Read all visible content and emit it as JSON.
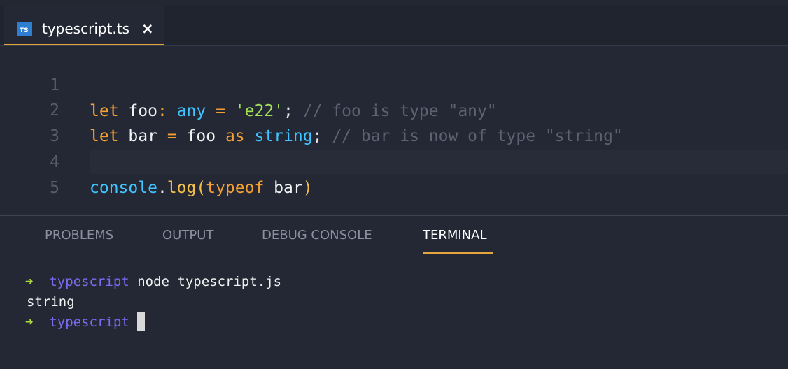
{
  "tab": {
    "icon_label": "TS",
    "title": "typescript.ts",
    "close_glyph": "×"
  },
  "editor": {
    "line_numbers": [
      "1",
      "2",
      "3",
      "4",
      "5"
    ],
    "line1": {
      "kw_let": "let",
      "name": "foo",
      "colon": ":",
      "type": "any",
      "eq": "=",
      "value": "'e22'",
      "semi": ";",
      "comment": "// foo is type \"any\""
    },
    "line2": {
      "kw_let": "let",
      "name": "bar",
      "eq": "=",
      "source": "foo",
      "kw_as": "as",
      "type": "string",
      "semi": ";",
      "comment": "// bar is now of type \"string\""
    },
    "line4": {
      "object": "console",
      "dot": ".",
      "method": "log",
      "open_paren": "(",
      "kw_typeof": "typeof",
      "arg": "bar",
      "close_paren": ")"
    }
  },
  "panel": {
    "tabs": [
      "PROBLEMS",
      "OUTPUT",
      "DEBUG CONSOLE",
      "TERMINAL"
    ],
    "active_tab": "TERMINAL"
  },
  "terminal": {
    "prompt_arrow": "➜",
    "cwd": "typescript",
    "command": "node typescript.js",
    "output": "string"
  },
  "colors": {
    "accent": "#e5a73d",
    "keyword": "#f5a033",
    "type": "#40c4ff",
    "string": "#a4e058",
    "comment": "#5b6272",
    "prompt_arrow": "#b5e03c",
    "prompt_dir": "#7a6cf0"
  }
}
